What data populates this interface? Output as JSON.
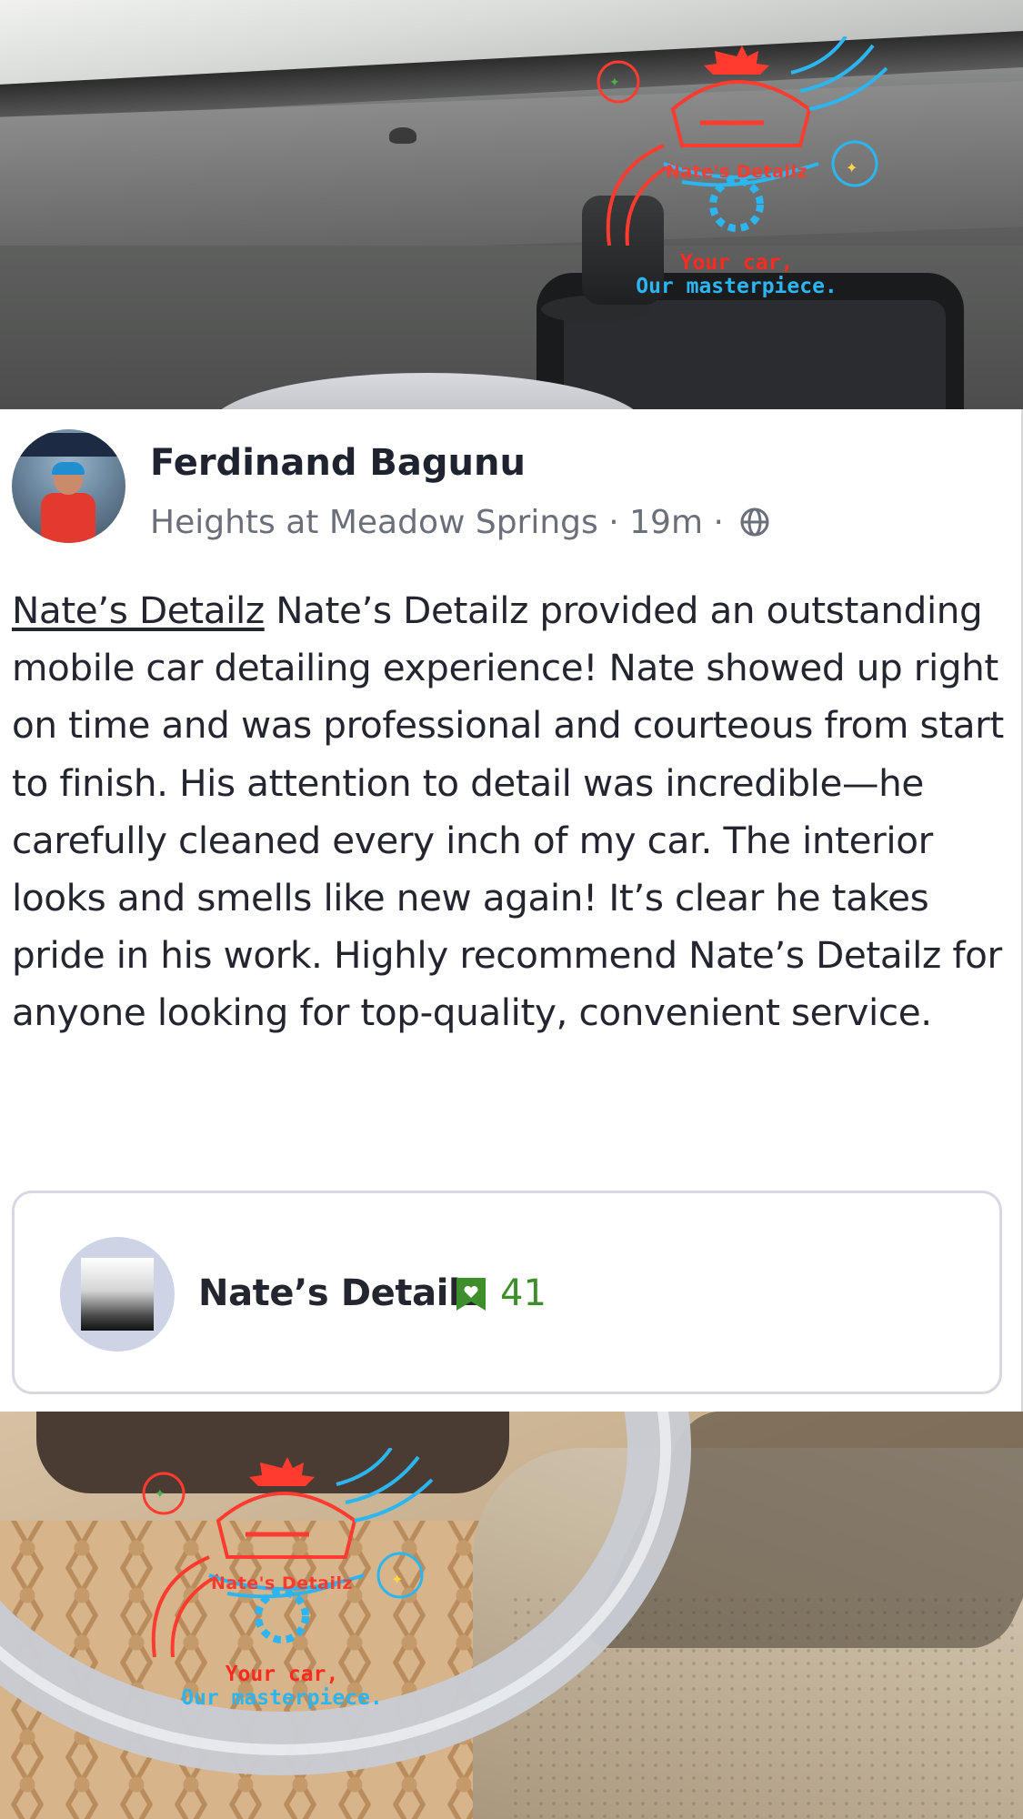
{
  "post": {
    "author": "Ferdinand Bagunu",
    "location": "Heights at Meadow Springs",
    "separator": " · ",
    "time": "19m",
    "mention": "Nate’s Detailz",
    "body": " Nate’s Detailz provided an outstanding mobile car detailing experience! Nate showed up right on time and was professional and courteous from start to finish. His attention to detail was incredible—he carefully cleaned every inch of my car. The interior looks and smells like new again! It’s clear he takes pride in his work. Highly recommend Nate’s Detailz for anyone looking for top-quality, convenient service."
  },
  "business": {
    "name": "Nate’s Detailz",
    "recommend_count": "41"
  },
  "watermark": {
    "name": "Nate's Detailz",
    "tagline_1": "Your car,",
    "tagline_2": "Our masterpiece."
  },
  "icons": {
    "privacy": "globe-icon",
    "recommendations": "bookmark-heart-icon"
  },
  "colors": {
    "text": "#23262f",
    "meta": "#6b6f7a",
    "recommend_green": "#3e8f2c",
    "logo_red": "#ff3b2f",
    "logo_blue": "#2bb6f2"
  }
}
